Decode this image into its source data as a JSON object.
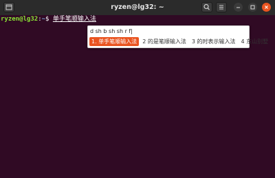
{
  "titlebar": {
    "title": "ryzen@lg32: ~"
  },
  "terminal": {
    "prompt_user": "ryzen@lg32",
    "prompt_sep": ":",
    "prompt_path": "~",
    "prompt_symbol": "$",
    "typed_text": "单手笔顺输入法"
  },
  "ime": {
    "preedit": "d sh b sh sh r f|",
    "candidates": [
      {
        "index": "1.",
        "text": "单手笔顺输入法"
      },
      {
        "index": "2",
        "text": "的是笔顺输入法"
      },
      {
        "index": "3",
        "text": "的时表示输入法"
      },
      {
        "index": "4",
        "text": "东山别墅"
      }
    ],
    "selected_index": 0
  },
  "colors": {
    "background": "#300a24",
    "titlebar": "#2b2b2b",
    "accent": "#e95420",
    "prompt_user": "#8ae234",
    "prompt_path": "#729fcf"
  },
  "icons": {
    "new_tab": "new-tab-icon",
    "search": "search-icon",
    "menu": "hamburger-menu-icon",
    "minimize": "minimize-icon",
    "maximize": "maximize-icon",
    "close": "close-icon"
  }
}
